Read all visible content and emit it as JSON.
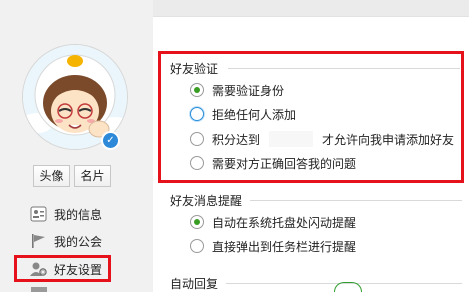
{
  "sidebar": {
    "buttons": {
      "avatar": "头像",
      "card": "名片"
    },
    "items": [
      {
        "label": "我的信息",
        "icon": "profile-card-icon"
      },
      {
        "label": "我的公会",
        "icon": "flag-icon"
      },
      {
        "label": "好友设置",
        "icon": "user-settings-icon",
        "selected": true
      }
    ],
    "badge_icon": "v-badge-icon"
  },
  "friend_verify": {
    "title": "好友验证",
    "options": [
      {
        "label": "需要验证身份",
        "checked": true
      },
      {
        "label": "拒绝任何人添加",
        "checked": false
      },
      {
        "prefix": "积分达到",
        "input_value": "",
        "suffix": "才允许向我申请添加好友",
        "checked": false
      },
      {
        "label": "需要对方正确回答我的问题",
        "checked": false
      }
    ]
  },
  "friend_msg": {
    "title": "好友消息提醒",
    "options": [
      {
        "label": "自动在系统托盘处闪动提醒",
        "checked": true
      },
      {
        "label": "直接弹出到任务栏进行提醒",
        "checked": false
      }
    ]
  },
  "auto_reply": {
    "title": "自动回复"
  },
  "colors": {
    "highlight": "#e5121b",
    "radio_checked": "#3a9d23",
    "focus": "#2a8fd8"
  }
}
